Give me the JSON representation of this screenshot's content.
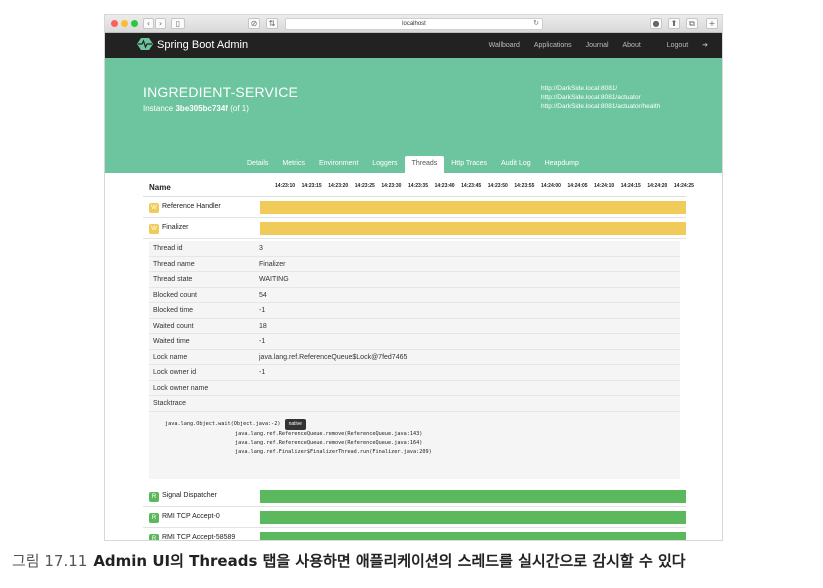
{
  "browser": {
    "url": "localhost",
    "buttons": [
      "‹",
      "›",
      "▯",
      "⊘",
      "⇅",
      "●",
      "⬆",
      "⧉",
      "+"
    ],
    "reload": "↻"
  },
  "app": {
    "brand": "Spring Boot Admin",
    "nav": [
      "Wallboard",
      "Applications",
      "Journal",
      "About",
      "Logout"
    ]
  },
  "instance": {
    "title": "INGREDIENT-SERVICE",
    "instance_prefix": "Instance",
    "instance_id": "3be305bc734f",
    "instance_suffix": "(of 1)",
    "urls": [
      "http://DarkSide.local:8081/",
      "http://DarkSide.local:8081/actuator",
      "http://DarkSide.local:8081/actuator/health"
    ]
  },
  "tabs": [
    {
      "label": "Details",
      "active": false
    },
    {
      "label": "Metrics",
      "active": false
    },
    {
      "label": "Environment",
      "active": false
    },
    {
      "label": "Loggers",
      "active": false
    },
    {
      "label": "Threads",
      "active": true
    },
    {
      "label": "Http Traces",
      "active": false
    },
    {
      "label": "Audit Log",
      "active": false
    },
    {
      "label": "Heapdump",
      "active": false
    }
  ],
  "threads": {
    "header": "Name",
    "ticks": [
      "14:23:10",
      "14:23:15",
      "14:23:20",
      "14:23:25",
      "14:23:30",
      "14:23:35",
      "14:23:40",
      "14:23:45",
      "14:23:50",
      "14:23:55",
      "14:24:00",
      "14:24:05",
      "14:24:10",
      "14:24:15",
      "14:24:20",
      "14:24:25"
    ],
    "rows_top": [
      {
        "badge": "W",
        "name": "Reference Handler",
        "color": "#f0cb5a"
      },
      {
        "badge": "W",
        "name": "Finalizer",
        "color": "#f0cb5a"
      }
    ],
    "details": [
      {
        "k": "Thread id",
        "v": "3"
      },
      {
        "k": "Thread name",
        "v": "Finalizer"
      },
      {
        "k": "Thread state",
        "v": "WAITING"
      },
      {
        "k": "Blocked count",
        "v": "54"
      },
      {
        "k": "Blocked time",
        "v": "-1"
      },
      {
        "k": "Waited count",
        "v": "18"
      },
      {
        "k": "Waited time",
        "v": "-1"
      },
      {
        "k": "Lock name",
        "v": "java.lang.ref.ReferenceQueue$Lock@7fed7465"
      },
      {
        "k": "Lock owner id",
        "v": "-1"
      },
      {
        "k": "Lock owner name",
        "v": ""
      },
      {
        "k": "Stacktrace",
        "v": ""
      }
    ],
    "stack_first": "java.lang.Object.wait(Object.java:-2)",
    "native_label": "native",
    "stack_rest": [
      "java.lang.ref.ReferenceQueue.remove(ReferenceQueue.java:143)",
      "java.lang.ref.ReferenceQueue.remove(ReferenceQueue.java:164)",
      "java.lang.ref.Finalizer$FinalizerThread.run(Finalizer.java:209)"
    ],
    "rows_bottom": [
      {
        "badge": "R",
        "name": "Signal Dispatcher",
        "color": "#5cb85c"
      },
      {
        "badge": "R",
        "name": "RMI TCP Accept-0",
        "color": "#5cb85c"
      },
      {
        "badge": "R",
        "name": "RMI TCP Accept-58589",
        "color": "#5cb85c"
      }
    ]
  },
  "caption": {
    "fig": "그림 17.11",
    "text": "Admin UI의 Threads 탭을 사용하면 애플리케이션의 스레드를 실시간으로 감시할 수 있다"
  }
}
